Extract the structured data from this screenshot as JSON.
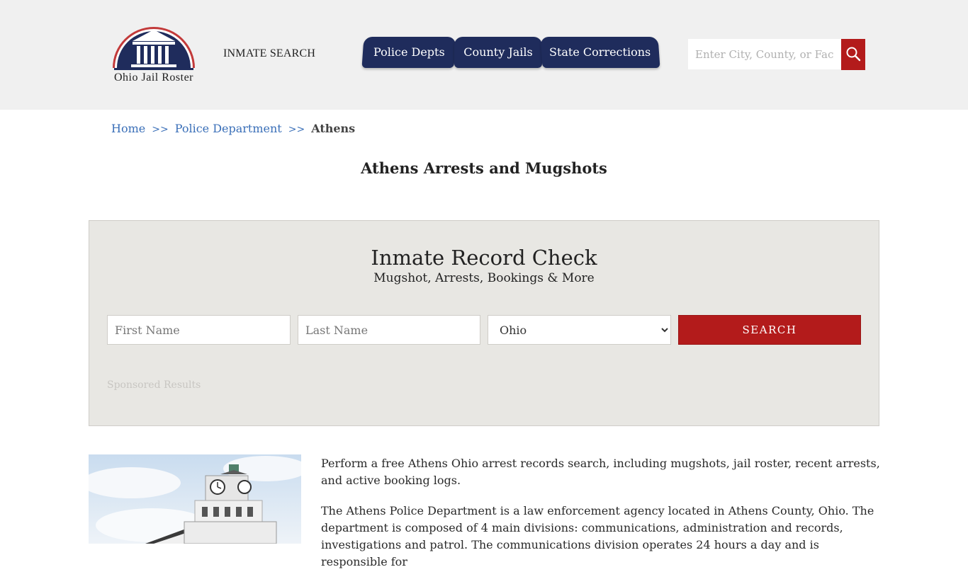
{
  "header": {
    "logo_text": "Ohio Jail Roster",
    "inmate_search_link": "INMATE SEARCH",
    "nav_tabs": [
      {
        "label": "Police Depts"
      },
      {
        "label": "County Jails"
      },
      {
        "label": "State Corrections"
      }
    ],
    "search_placeholder": "Enter City, County, or Facility"
  },
  "breadcrumb": {
    "items": [
      "Home",
      "Police Department"
    ],
    "separator": ">>",
    "current": "Athens"
  },
  "page_title": "Athens Arrests and Mugshots",
  "record_check": {
    "title": "Inmate Record Check",
    "subtitle": "Mugshot, Arrests, Bookings & More",
    "first_name_placeholder": "First Name",
    "last_name_placeholder": "Last Name",
    "state_selected": "Ohio",
    "search_label": "SEARCH",
    "sponsored_label": "Sponsored Results"
  },
  "content": {
    "paragraphs": [
      "Perform a free Athens Ohio arrest records search, including mugshots, jail roster, recent arrests, and active booking logs.",
      "The Athens Police Department is a law enforcement agency located in Athens County, Ohio. The department is composed of 4 main divisions: communications, administration and records, investigations and patrol. The communications division operates 24 hours a day and is responsible for"
    ]
  },
  "colors": {
    "nav_bg": "#1f2c5c",
    "accent_red": "#b31b1b",
    "link_blue": "#3a6fb8",
    "panel_bg": "#e8e7e3"
  }
}
